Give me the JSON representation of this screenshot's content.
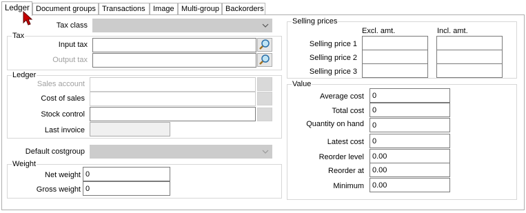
{
  "tabs": [
    {
      "label": "Ledger",
      "active": true
    },
    {
      "label": "Document groups"
    },
    {
      "label": "Transactions"
    },
    {
      "label": "Image"
    },
    {
      "label": "Multi-group"
    },
    {
      "label": "Backorders"
    }
  ],
  "tax_class": {
    "label": "Tax class",
    "value": ""
  },
  "tax": {
    "title": "Tax",
    "input_tax_label": "Input tax",
    "input_tax_value": "",
    "output_tax_label": "Output tax",
    "output_tax_value": ""
  },
  "ledger": {
    "title": "Ledger",
    "sales_account_label": "Sales account",
    "sales_account_value": "",
    "cost_of_sales_label": "Cost of sales",
    "cost_of_sales_value": "",
    "stock_control_label": "Stock control",
    "stock_control_value": "",
    "last_invoice_label": "Last invoice",
    "last_invoice_value": ""
  },
  "default_costgroup": {
    "label": "Default costgroup",
    "value": ""
  },
  "weight": {
    "title": "Weight",
    "net_label": "Net weight",
    "net_value": "0",
    "gross_label": "Gross weight",
    "gross_value": "0"
  },
  "selling_prices": {
    "title": "Selling prices",
    "col_excl": "Excl. amt.",
    "col_incl": "Incl. amt.",
    "rows": [
      {
        "label": "Selling price 1",
        "excl": "",
        "incl": ""
      },
      {
        "label": "Selling price 2",
        "excl": "",
        "incl": ""
      },
      {
        "label": "Selling price 3",
        "excl": "",
        "incl": ""
      }
    ]
  },
  "value": {
    "title": "Value",
    "rows": [
      {
        "label": "Average cost",
        "value": "0"
      },
      {
        "label": "Total cost",
        "value": "0"
      },
      {
        "label": "Quantity on hand",
        "value": "0"
      },
      {
        "label": "Latest cost",
        "value": "0"
      },
      {
        "label": "Reorder level",
        "value": "0.00"
      },
      {
        "label": "Reorder at",
        "value": "0.00"
      },
      {
        "label": "Minimum",
        "value": "0.00"
      }
    ]
  },
  "colors": {
    "cursor": "#c80000",
    "border": "#7a7a7a",
    "disabled": "#cccccc"
  }
}
